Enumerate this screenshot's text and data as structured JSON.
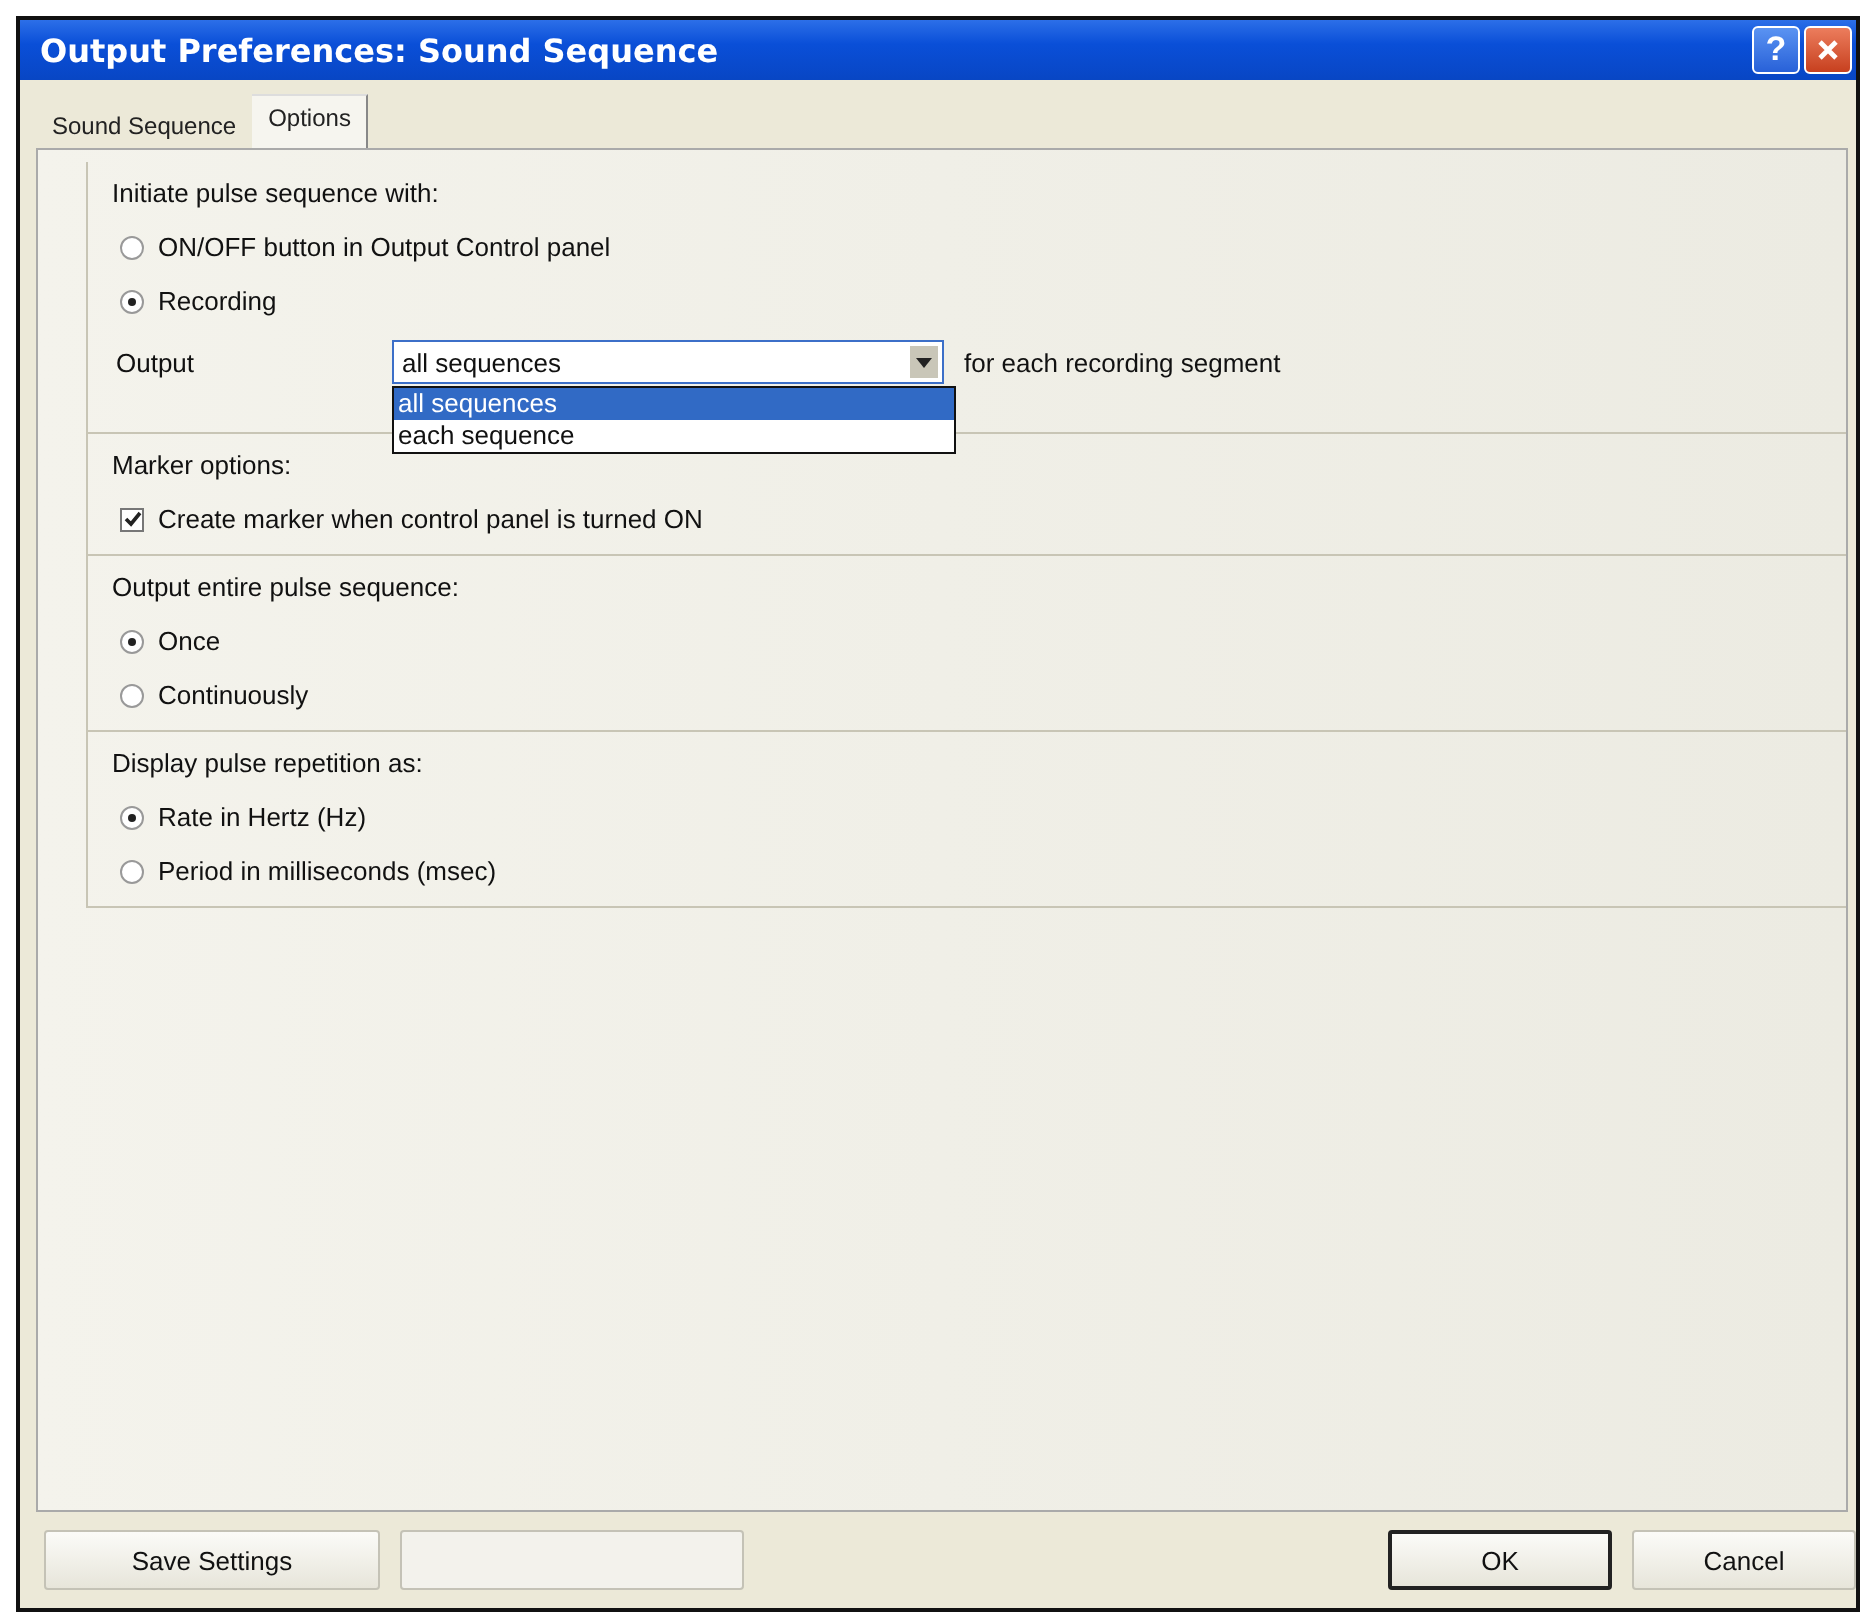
{
  "window": {
    "title": "Output Preferences: Sound Sequence",
    "controls": [
      {
        "kind": "help",
        "label": "?"
      },
      {
        "kind": "close"
      }
    ]
  },
  "tabs": [
    {
      "label": "Sound Sequence",
      "selected": false
    },
    {
      "label": "Options",
      "selected": true
    }
  ],
  "groups": [
    {
      "title": "Initiate pulse sequence with:",
      "items": [
        {
          "kind": "radio",
          "label": "ON/OFF button in Output Control panel",
          "selected": false
        },
        {
          "kind": "radio",
          "label": "Recording",
          "selected": true
        },
        {
          "kind": "dropdown",
          "label": "Output",
          "value": "all sequences",
          "suffix": "for each recording segment",
          "expanded": true,
          "options": [
            {
              "label": "all sequences",
              "selected": true
            },
            {
              "label": "each sequence",
              "selected": false
            }
          ]
        }
      ]
    },
    {
      "title": "Marker options:",
      "items": [
        {
          "kind": "checkbox",
          "label": "Create marker when control panel is turned ON",
          "checked": true
        }
      ]
    },
    {
      "title": "Output entire pulse sequence:",
      "items": [
        {
          "kind": "radio",
          "label": "Once",
          "selected": true
        },
        {
          "kind": "radio",
          "label": "Continuously",
          "selected": false
        }
      ]
    },
    {
      "title": "Display pulse repetition as:",
      "items": [
        {
          "kind": "radio",
          "label": "Rate in Hertz (Hz)",
          "selected": true
        },
        {
          "kind": "radio",
          "label": "Period in milliseconds (msec)",
          "selected": false
        }
      ]
    }
  ],
  "buttons": {
    "left": [
      {
        "label": "Save Settings",
        "disabled": false,
        "default": false
      },
      {
        "disabled": true,
        "default": false
      }
    ],
    "right": [
      {
        "label": "OK",
        "disabled": false,
        "default": true
      },
      {
        "label": "Cancel",
        "disabled": false,
        "default": false
      }
    ]
  }
}
